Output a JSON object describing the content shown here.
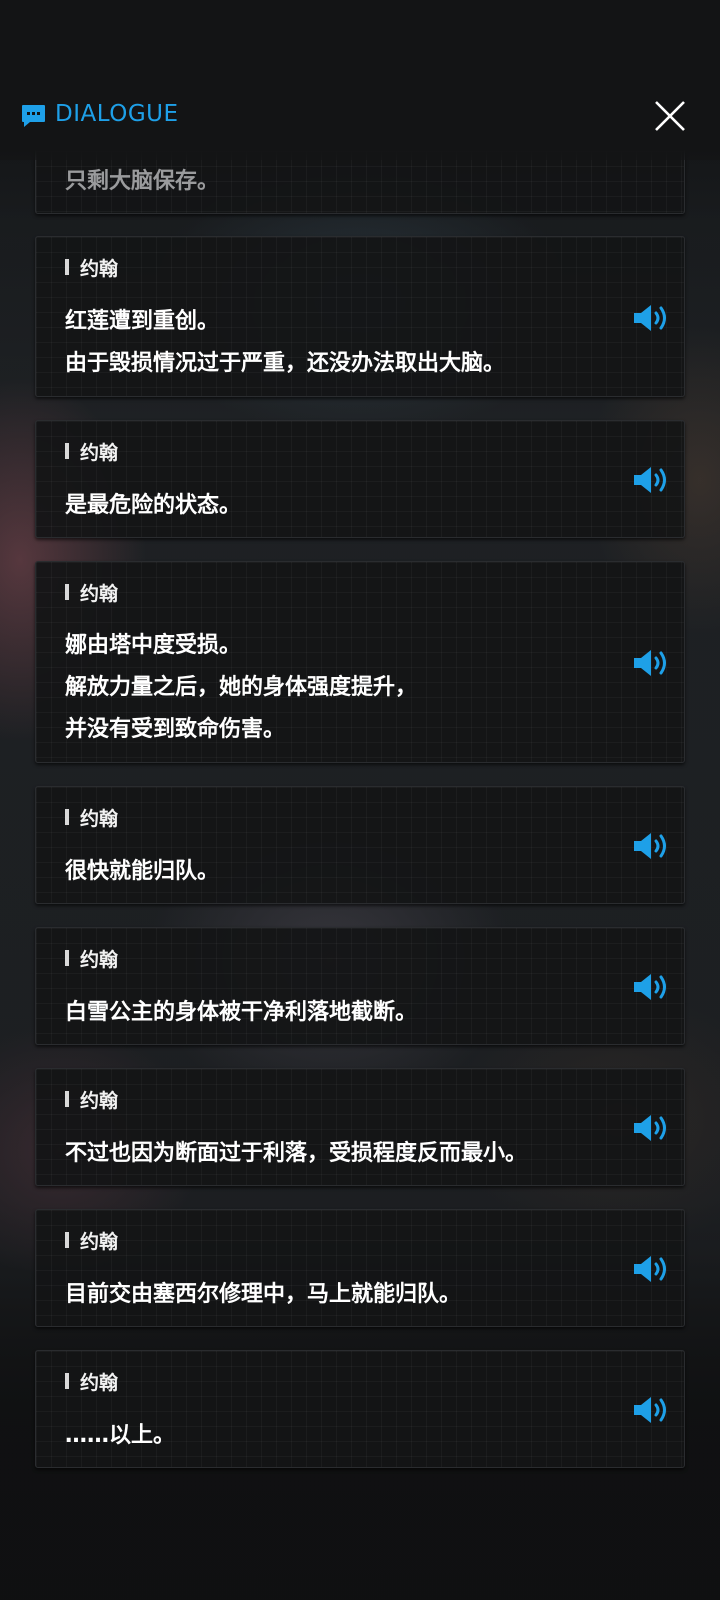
{
  "header": {
    "title": "DIALOGUE"
  },
  "entries": [
    {
      "speaker": "",
      "lines": [
        "只剩大脑保存。"
      ]
    },
    {
      "speaker": "约翰",
      "lines": [
        "红莲遭到重创。",
        "由于毁损情况过于严重，还没办法取出大脑。"
      ]
    },
    {
      "speaker": "约翰",
      "lines": [
        "是最危险的状态。"
      ]
    },
    {
      "speaker": "约翰",
      "lines": [
        "娜由塔中度受损。",
        "解放力量之后，她的身体强度提升，",
        "并没有受到致命伤害。"
      ]
    },
    {
      "speaker": "约翰",
      "lines": [
        "很快就能归队。"
      ]
    },
    {
      "speaker": "约翰",
      "lines": [
        "白雪公主的身体被干净利落地截断。"
      ]
    },
    {
      "speaker": "约翰",
      "lines": [
        "不过也因为断面过于利落，受损程度反而最小。"
      ]
    },
    {
      "speaker": "约翰",
      "lines": [
        "目前交由塞西尔修理中，马上就能归队。"
      ]
    },
    {
      "speaker": "约翰",
      "lines": [
        "……以上。"
      ]
    }
  ],
  "icons": {
    "header": "chat-bubble-icon",
    "close": "close-icon",
    "voice": "speaker-volume-icon"
  },
  "colors": {
    "accent": "#1ea0e8",
    "card_bg": "#141517",
    "text": "#ffffff"
  }
}
